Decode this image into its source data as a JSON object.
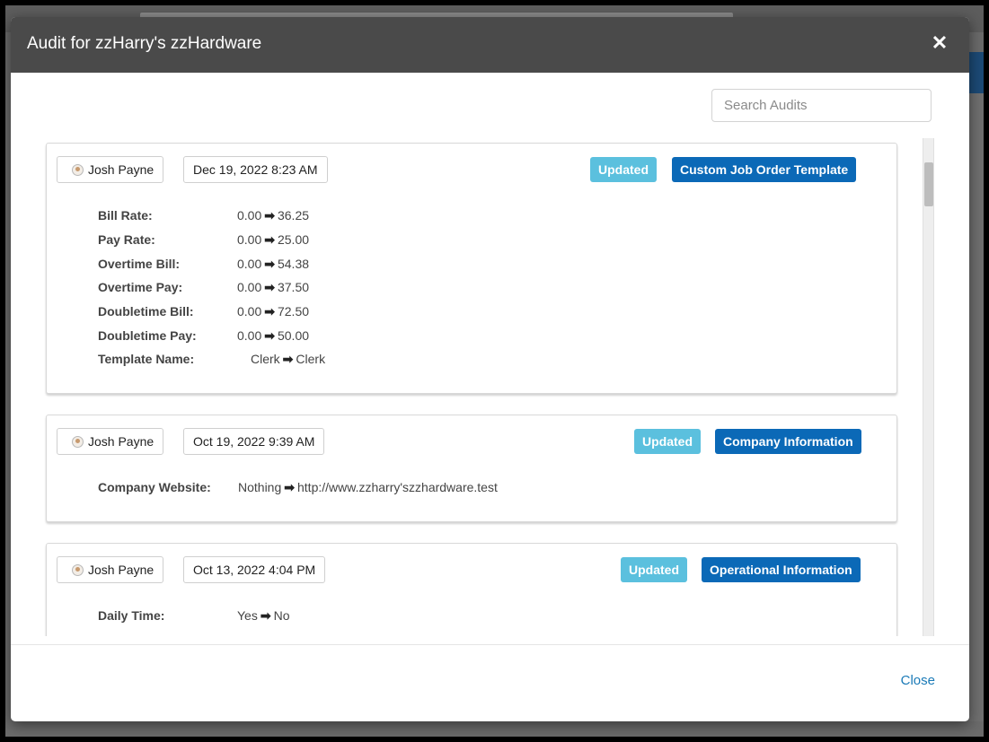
{
  "modal": {
    "title": "Audit for zzHarry's zzHardware",
    "close_x": "✕",
    "footer_close_label": "Close"
  },
  "search": {
    "placeholder": "Search Audits",
    "value": ""
  },
  "audits": [
    {
      "user": "Josh Payne",
      "date": "Dec 19, 2022 8:23 AM",
      "status": "Updated",
      "section": "Custom Job Order Template",
      "changes": [
        {
          "label": "Bill Rate:",
          "from": "0.00",
          "to": "36.25"
        },
        {
          "label": "Pay Rate:",
          "from": "0.00",
          "to": "25.00"
        },
        {
          "label": "Overtime Bill:",
          "from": "0.00",
          "to": "54.38"
        },
        {
          "label": "Overtime Pay:",
          "from": "0.00",
          "to": "37.50"
        },
        {
          "label": "Doubletime Bill:",
          "from": "0.00",
          "to": "72.50"
        },
        {
          "label": "Doubletime Pay:",
          "from": "0.00",
          "to": "50.00"
        },
        {
          "label": "Template Name:",
          "from": "Clerk",
          "to": "Clerk"
        }
      ]
    },
    {
      "user": "Josh Payne",
      "date": "Oct 19, 2022 9:39 AM",
      "status": "Updated",
      "section": "Company Information",
      "changes": [
        {
          "label": "Company Website:",
          "from": "Nothing",
          "to": "http://www.zzharry'szzhardware.test"
        }
      ]
    },
    {
      "user": "Josh Payne",
      "date": "Oct 13, 2022 4:04 PM",
      "status": "Updated",
      "section": "Operational Information",
      "changes": [
        {
          "label": "Daily Time:",
          "from": "Yes",
          "to": "No"
        }
      ]
    }
  ],
  "colors": {
    "header_bg": "#4a4a4a",
    "updated_badge": "#5bc0de",
    "section_badge": "#0b69b7",
    "link": "#1a7ab7"
  }
}
